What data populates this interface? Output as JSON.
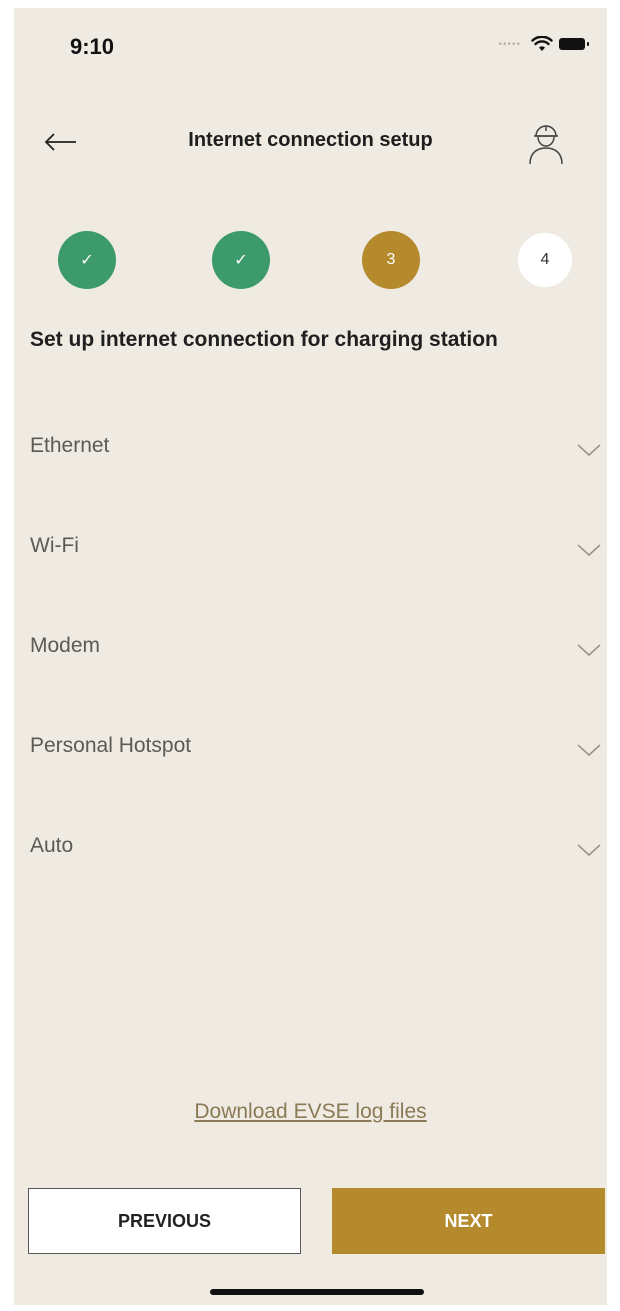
{
  "status_bar": {
    "time": "9:10"
  },
  "header": {
    "title": "Internet connection setup"
  },
  "stepper": {
    "steps": [
      {
        "label": "✓",
        "state": "done"
      },
      {
        "label": "✓",
        "state": "done"
      },
      {
        "label": "3",
        "state": "active"
      },
      {
        "label": "4",
        "state": "todo"
      }
    ]
  },
  "subtitle": "Set up internet connection for charging station",
  "options": [
    {
      "label": "Ethernet"
    },
    {
      "label": "Wi-Fi"
    },
    {
      "label": "Modem"
    },
    {
      "label": "Personal Hotspot"
    },
    {
      "label": "Auto"
    }
  ],
  "download_link": "Download EVSE log files",
  "buttons": {
    "previous": "PREVIOUS",
    "next": "NEXT"
  },
  "colors": {
    "background": "#efebe2",
    "step_done": "#3d9a6b",
    "accent": "#b58a2d",
    "link": "#8a7a55"
  }
}
